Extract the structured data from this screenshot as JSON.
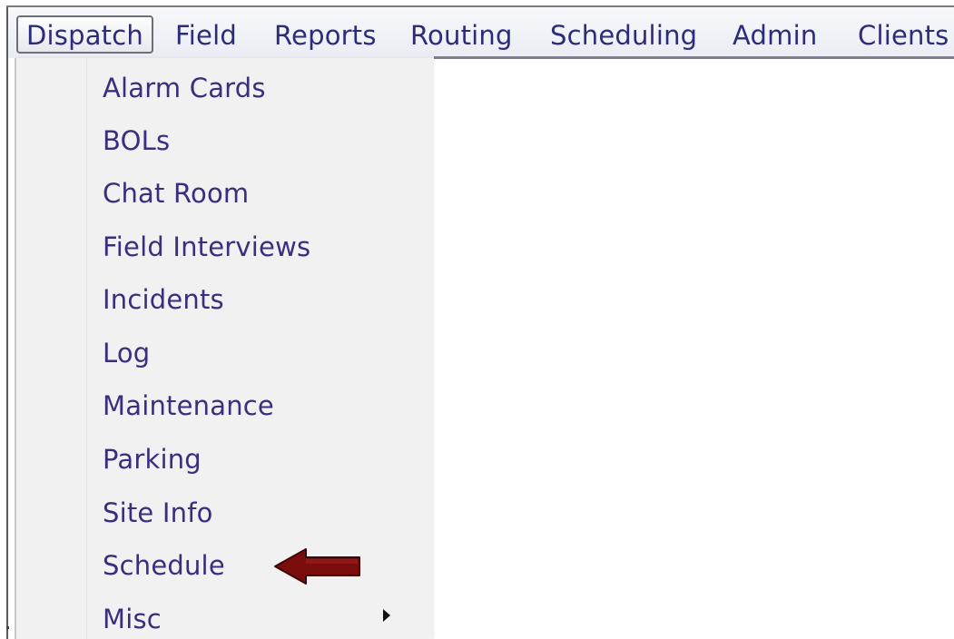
{
  "menubar": {
    "items": [
      {
        "label": "Dispatch",
        "active": true
      },
      {
        "label": "Field"
      },
      {
        "label": "Reports"
      },
      {
        "label": "Routing"
      },
      {
        "label": "Scheduling"
      },
      {
        "label": "Admin"
      },
      {
        "label": "Clients"
      }
    ]
  },
  "dispatch_menu": {
    "items": [
      {
        "label": "Alarm Cards"
      },
      {
        "label": "BOLs"
      },
      {
        "label": "Chat Room"
      },
      {
        "label": "Field Interviews"
      },
      {
        "label": "Incidents"
      },
      {
        "label": "Log"
      },
      {
        "label": "Maintenance"
      },
      {
        "label": "Parking"
      },
      {
        "label": "Site Info"
      },
      {
        "label": "Schedule"
      },
      {
        "label": "Misc",
        "has_submenu": true
      }
    ],
    "submenu_icon": "chevron-right-icon"
  },
  "annotation": {
    "icon": "left-arrow-icon",
    "color": "#7a0c0c"
  },
  "colors": {
    "menu_text": "#2c2c7a",
    "dropdown_bg": "#f1f1f1"
  }
}
